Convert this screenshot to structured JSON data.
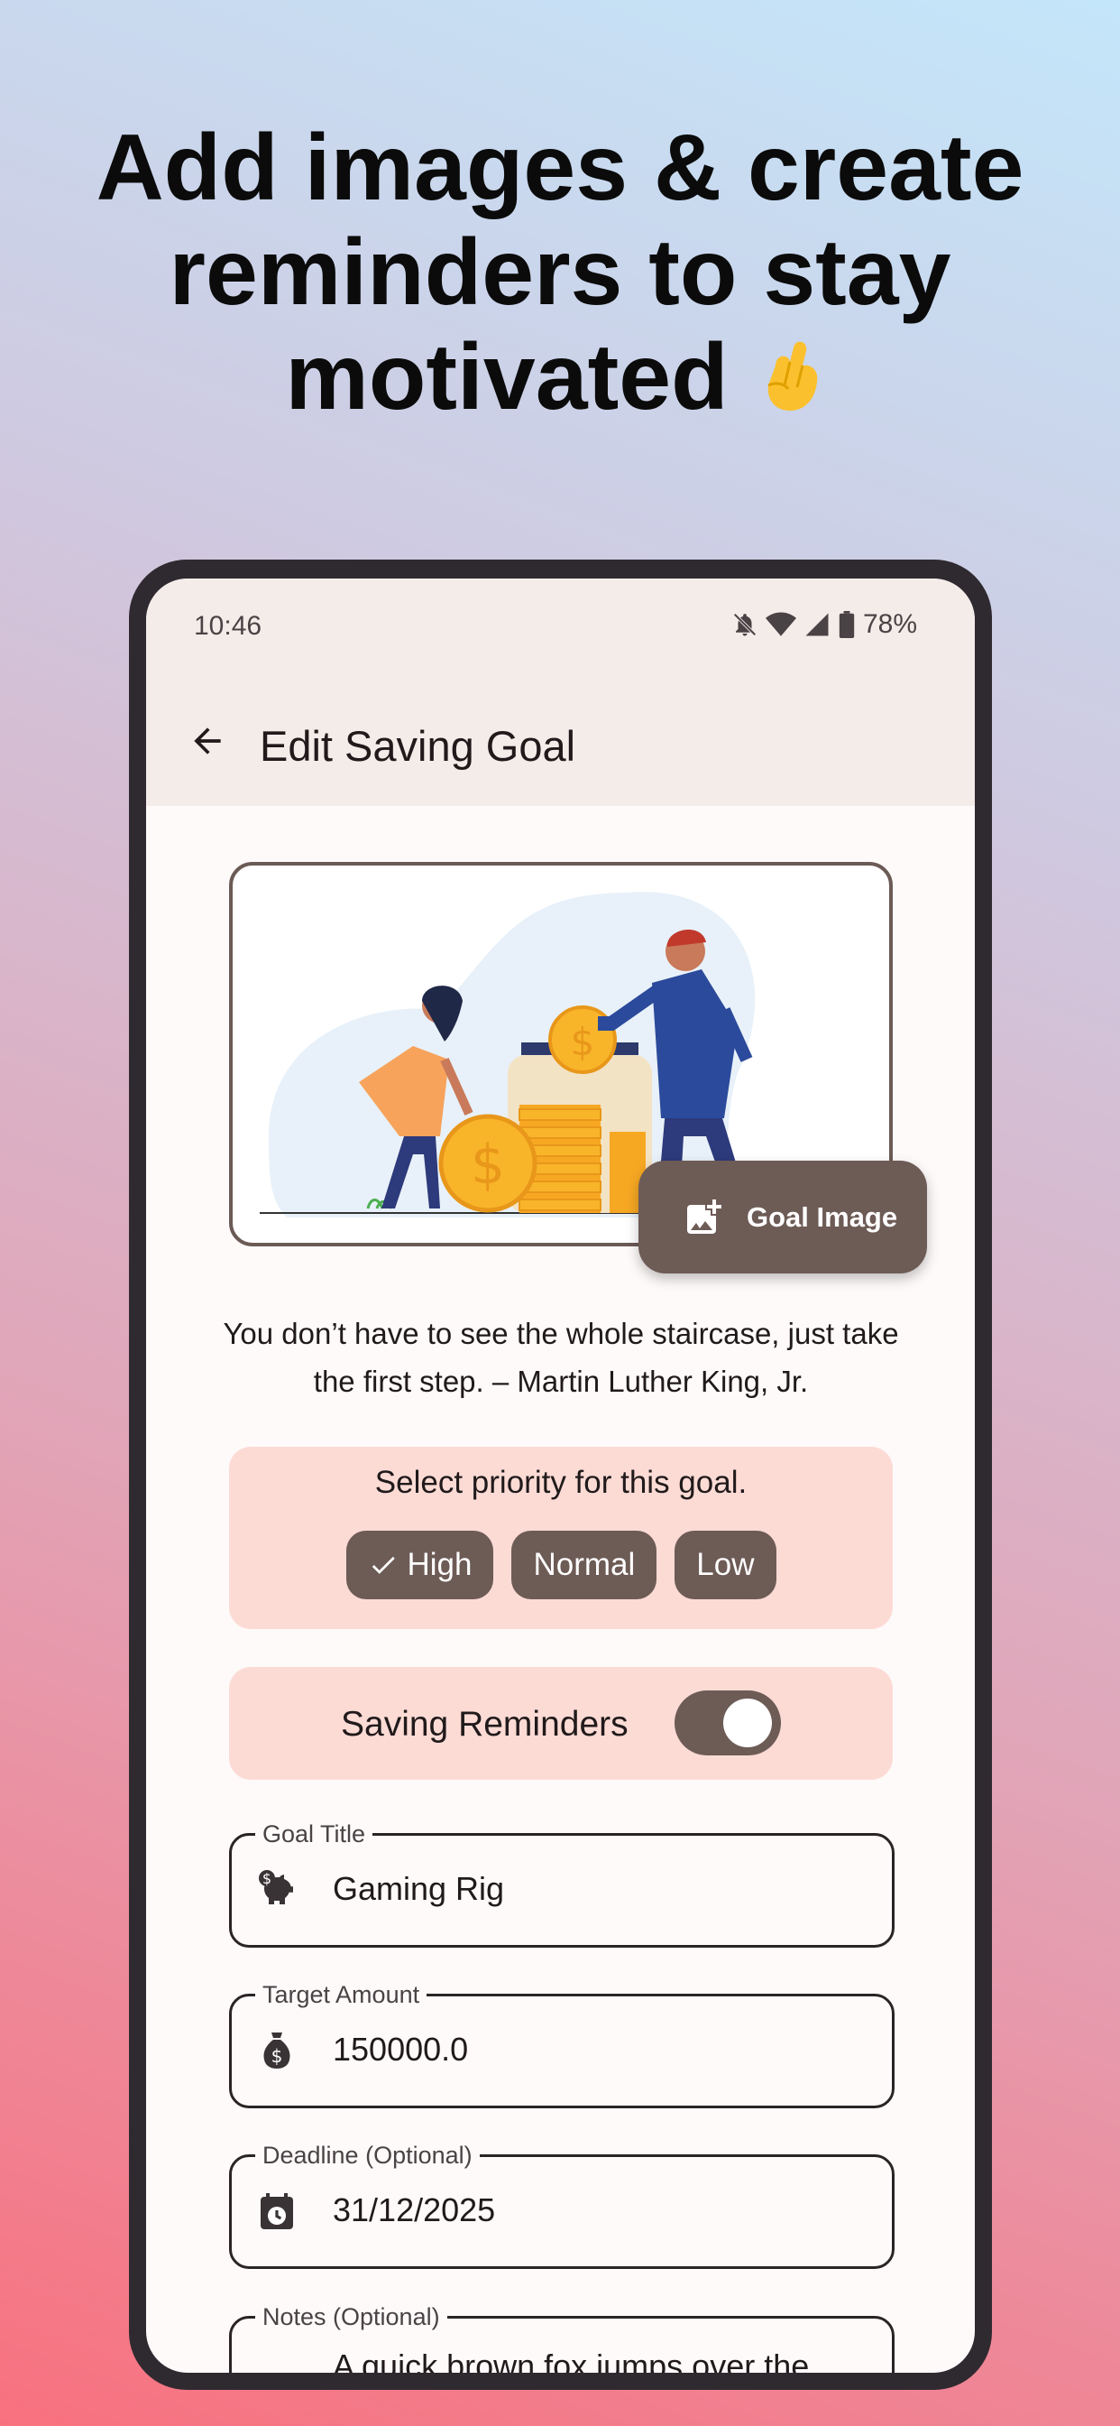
{
  "headline": {
    "line1": "Add images & create",
    "line2": "reminders to stay",
    "line3": "motivated"
  },
  "status_bar": {
    "time": "10:46",
    "battery": "78%"
  },
  "app_bar": {
    "title": "Edit Saving Goal"
  },
  "goal_image": {
    "button_label": "Goal Image"
  },
  "quote": "You don’t have to see the whole staircase, just take the first step. – Martin Luther King, Jr.",
  "priority": {
    "title": "Select priority for this goal.",
    "options": [
      "High",
      "Normal",
      "Low"
    ],
    "selected": "High"
  },
  "reminders": {
    "label": "Saving Reminders",
    "enabled": true
  },
  "fields": {
    "goal_title": {
      "label": "Goal Title",
      "value": "Gaming Rig"
    },
    "target_amount": {
      "label": "Target Amount",
      "value": "150000.0"
    },
    "deadline": {
      "label": "Deadline (Optional)",
      "value": "31/12/2025"
    },
    "notes": {
      "label": "Notes (Optional)",
      "value": "A quick brown fox jumps over the"
    }
  },
  "colors": {
    "accent": "#6d5b56",
    "card": "#fddbd5",
    "surface": "#fefafa",
    "appbar": "#f4ece9"
  }
}
